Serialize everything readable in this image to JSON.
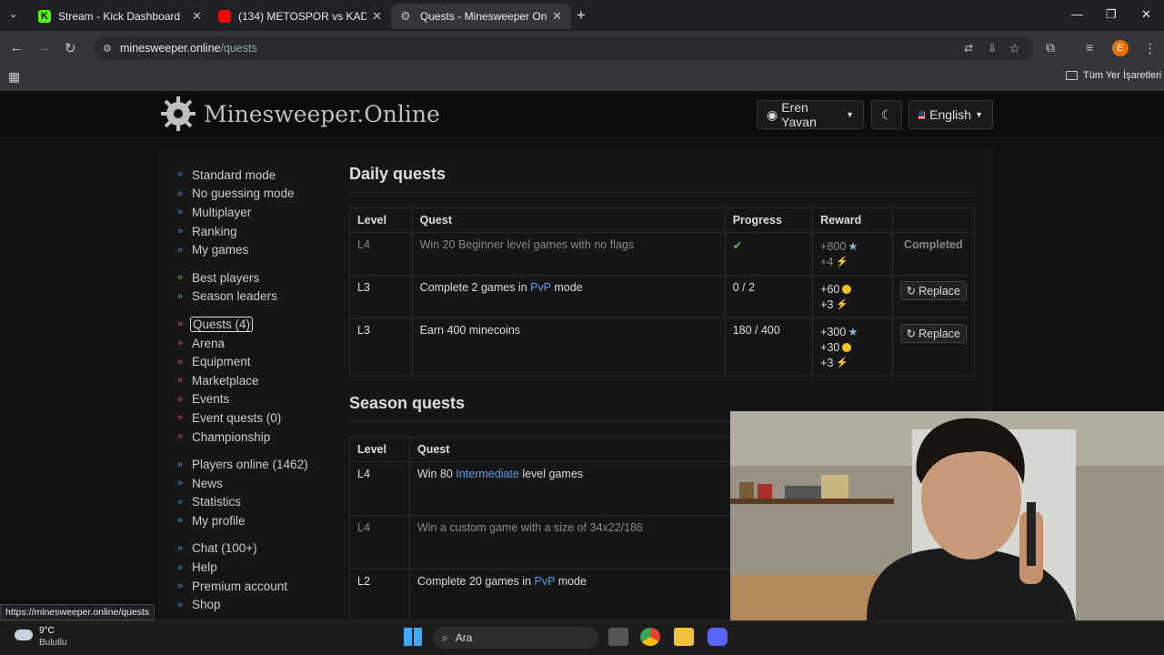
{
  "browser": {
    "tabs": [
      {
        "title": "Stream - Kick Dashboard",
        "active": false
      },
      {
        "title": "(134) METOSPOR vs KADİM FUT",
        "active": false
      },
      {
        "title": "Quests - Minesweeper Online",
        "active": true
      }
    ],
    "url_host": "minesweeper.online",
    "url_path": "/quests",
    "bookmarks_label": "Tüm Yer İşaretleri",
    "profile_initial": "E"
  },
  "site": {
    "logo_text": "Minesweeper.Online",
    "user_label": "Eren Yavan",
    "language_label": "English"
  },
  "nav": [
    {
      "label": "Standard mode",
      "color": "#4a90d9"
    },
    {
      "label": "No guessing mode",
      "color": "#4a90d9"
    },
    {
      "label": "Multiplayer",
      "color": "#4a90d9"
    },
    {
      "label": "Ranking",
      "color": "#4a90d9"
    },
    {
      "label": "My games",
      "color": "#4a90d9"
    },
    {
      "gap": true
    },
    {
      "label": "Best players",
      "color": "#5cb85c"
    },
    {
      "label": "Season leaders",
      "color": "#5cb85c"
    },
    {
      "gap": true
    },
    {
      "label": "Quests (4)",
      "color": "#d9534f",
      "highlight": true
    },
    {
      "label": "Arena",
      "color": "#d9534f"
    },
    {
      "label": "Equipment",
      "color": "#d9534f"
    },
    {
      "label": "Marketplace",
      "color": "#d9534f"
    },
    {
      "label": "Events",
      "color": "#d9534f"
    },
    {
      "label": "Event quests (0)",
      "color": "#d9534f"
    },
    {
      "label": "Championship",
      "color": "#d9534f"
    },
    {
      "gap": true
    },
    {
      "label": "Players online (1462)",
      "color": "#4a90d9"
    },
    {
      "label": "News",
      "color": "#4a90d9"
    },
    {
      "label": "Statistics",
      "color": "#4a90d9"
    },
    {
      "label": "My profile",
      "color": "#4a90d9"
    },
    {
      "gap": true
    },
    {
      "label": "Chat (100+)",
      "color": "#4a90d9"
    },
    {
      "label": "Help",
      "color": "#4a90d9"
    },
    {
      "label": "Premium account",
      "color": "#4a90d9"
    },
    {
      "label": "Shop",
      "color": "#4a90d9"
    }
  ],
  "daily": {
    "title": "Daily quests",
    "headers": [
      "Level",
      "Quest",
      "Progress",
      "Reward",
      ""
    ],
    "rows": [
      {
        "level": "L4",
        "quest": [
          "Win 20 Beginner level games with no flags"
        ],
        "progress": "✔",
        "rewards": [
          {
            "v": "+800",
            "icon": "star"
          },
          {
            "v": "+4",
            "icon": "bolt"
          }
        ],
        "action": "Completed",
        "muted": true
      },
      {
        "level": "L3",
        "quest": [
          "Complete 2 games in ",
          "PvP",
          " mode"
        ],
        "progress": "0 / 2",
        "rewards": [
          {
            "v": "+60",
            "icon": "coin"
          },
          {
            "v": "+3",
            "icon": "bolt"
          }
        ],
        "action": "Replace"
      },
      {
        "level": "L3",
        "quest": [
          "Earn 400 minecoins"
        ],
        "progress": "180 / 400",
        "rewards": [
          {
            "v": "+300",
            "icon": "star"
          },
          {
            "v": "+30",
            "icon": "coin"
          },
          {
            "v": "+3",
            "icon": "bolt"
          }
        ],
        "action": "Replace"
      }
    ]
  },
  "season": {
    "title": "Season quests",
    "headers": [
      "Level",
      "Quest"
    ],
    "rows": [
      {
        "level": "L4",
        "quest": [
          "Win 80 ",
          "Intermediate",
          " level games"
        ]
      },
      {
        "level": "L4",
        "quest": [
          "Win a custom game with a size of 34x22/186"
        ],
        "muted": true
      },
      {
        "level": "L2",
        "quest": [
          "Complete 20 games in ",
          "PvP",
          " mode"
        ]
      }
    ]
  },
  "status_url": "https://minesweeper.online/quests",
  "weather": {
    "temp": "9°C",
    "desc": "Bulutlu"
  },
  "search_label": "Ara"
}
